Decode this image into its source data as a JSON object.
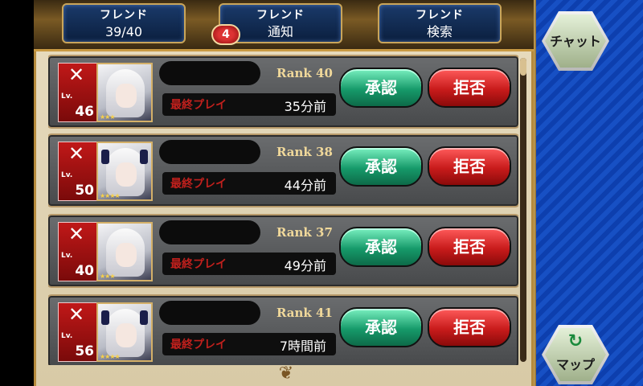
{
  "tabs": [
    {
      "title": "フレンド",
      "sub": "39/40"
    },
    {
      "title": "フレンド",
      "sub": "通知"
    },
    {
      "title": "フレンド",
      "sub": "検索"
    }
  ],
  "notification_count": "4",
  "rows": [
    {
      "lv_label": "Lv.",
      "lv": "46",
      "rank": "Rank 40",
      "play_label": "最終プレイ",
      "play_time": "35分前",
      "accept": "承認",
      "reject": "拒否",
      "portrait": "white-hair"
    },
    {
      "lv_label": "Lv.",
      "lv": "50",
      "rank": "Rank 38",
      "play_label": "最終プレイ",
      "play_time": "44分前",
      "accept": "承認",
      "reject": "拒否",
      "portrait": "horned"
    },
    {
      "lv_label": "Lv.",
      "lv": "40",
      "rank": "Rank 37",
      "play_label": "最終プレイ",
      "play_time": "49分前",
      "accept": "承認",
      "reject": "拒否",
      "portrait": "white-hair"
    },
    {
      "lv_label": "Lv.",
      "lv": "56",
      "rank": "Rank 41",
      "play_label": "最終プレイ",
      "play_time": "7時間前",
      "accept": "承認",
      "reject": "拒否",
      "portrait": "horned"
    }
  ],
  "side": {
    "chat": "チャット",
    "map": "マップ"
  },
  "colors": {
    "accept": "#169a6a",
    "reject": "#c81b1b",
    "rank": "#f0d89a",
    "side_blue": "#1750c4"
  }
}
